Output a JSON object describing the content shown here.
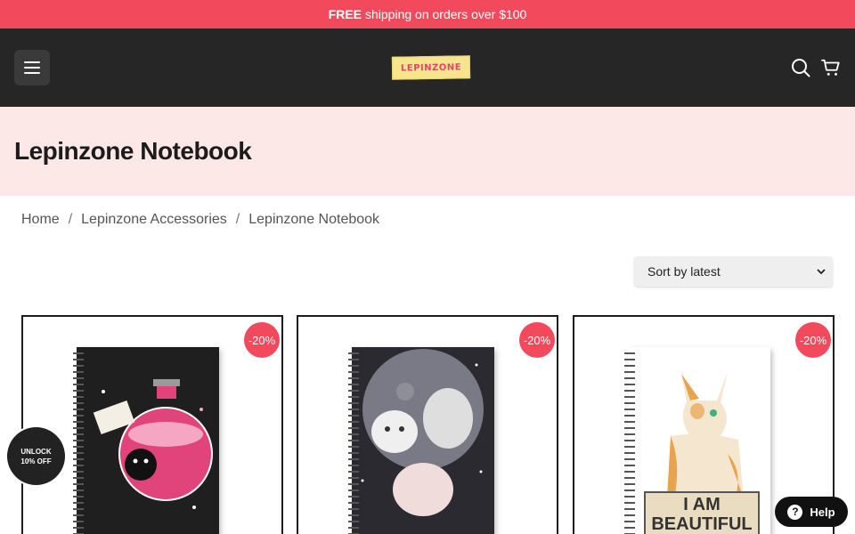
{
  "topbar": {
    "free": "FREE",
    "message": "shipping on orders over $100"
  },
  "header": {
    "logo_text": "LEPINZONE",
    "menu_icon": "hamburger-icon",
    "search_icon": "search-icon",
    "cart_icon": "cart-icon"
  },
  "page": {
    "title": "Lepinzone Notebook"
  },
  "breadcrumb": {
    "items": [
      "Home",
      "Lepinzone Accessories",
      "Lepinzone Notebook"
    ],
    "separator": "/"
  },
  "sort": {
    "selected": "Sort by latest"
  },
  "products": [
    {
      "badge": "-20%"
    },
    {
      "badge": "-20%"
    },
    {
      "badge": "-20%",
      "cover_text": "I AM BEAUTIFUL"
    }
  ],
  "unlock": {
    "line1": "UNLOCK",
    "line2": "10% OFF"
  },
  "help": {
    "label": "Help",
    "icon": "question-icon"
  },
  "colors": {
    "accent": "#f2495c",
    "header_bg": "#262626",
    "hero_bg": "#fde8e8"
  }
}
